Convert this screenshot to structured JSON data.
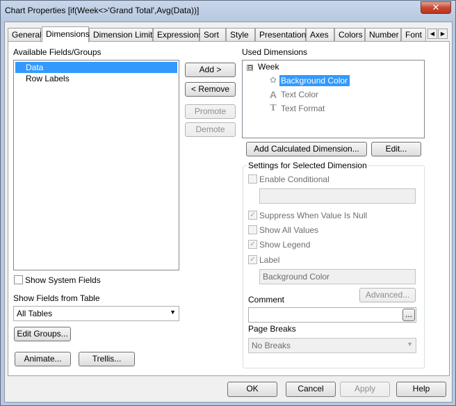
{
  "window": {
    "title": "Chart Properties [if(Week<>'Grand Total',Avg(Data))]",
    "close_glyph": "✕"
  },
  "tabs": [
    {
      "label": "General"
    },
    {
      "label": "Dimensions"
    },
    {
      "label": "Dimension Limits"
    },
    {
      "label": "Expressions"
    },
    {
      "label": "Sort"
    },
    {
      "label": "Style"
    },
    {
      "label": "Presentation"
    },
    {
      "label": "Axes"
    },
    {
      "label": "Colors"
    },
    {
      "label": "Number"
    },
    {
      "label": "Font"
    }
  ],
  "tab_scroll": {
    "left": "◀",
    "right": "▶"
  },
  "available": {
    "heading": "Available Fields/Groups",
    "items": [
      {
        "label": "Data"
      },
      {
        "label": "Row Labels"
      }
    ]
  },
  "middle_buttons": {
    "add": "Add >",
    "remove": "< Remove",
    "promote": "Promote",
    "demote": "Demote"
  },
  "used": {
    "heading": "Used Dimensions",
    "root": {
      "label": "Week",
      "toggle": "⊟"
    },
    "children": [
      {
        "label": "Background Color",
        "icon": "palette-icon",
        "glyph": "✿"
      },
      {
        "label": "Text Color",
        "icon": "text-color-icon",
        "glyph": "A"
      },
      {
        "label": "Text Format",
        "icon": "text-format-icon",
        "glyph": "T"
      }
    ],
    "add_calc_label": "Add Calculated Dimension...",
    "edit_label": "Edit..."
  },
  "settings": {
    "title": "Settings for Selected Dimension",
    "enable_conditional": {
      "label": "Enable Conditional",
      "checked": false
    },
    "conditional_value": "",
    "suppress_null": {
      "label": "Suppress When Value Is Null",
      "checked": true
    },
    "show_all_values": {
      "label": "Show All Values",
      "checked": false
    },
    "show_legend": {
      "label": "Show Legend",
      "checked": true
    },
    "label": {
      "label": "Label",
      "checked": true
    },
    "label_value": "Background Color",
    "advanced_label": "Advanced...",
    "comment_heading": "Comment",
    "comment_value": "",
    "comment_button": "...",
    "page_breaks_heading": "Page Breaks",
    "page_breaks_value": "No Breaks"
  },
  "left_lower": {
    "show_system_fields": {
      "label": "Show System Fields",
      "checked": false
    },
    "show_fields_heading": "Show Fields from Table",
    "table_value": "All Tables",
    "edit_groups": "Edit Groups...",
    "animate": "Animate...",
    "trellis": "Trellis..."
  },
  "footer": {
    "ok": "OK",
    "cancel": "Cancel",
    "apply": "Apply",
    "help": "Help"
  },
  "checkmark": "✓",
  "dropdown_glyph": "▼"
}
